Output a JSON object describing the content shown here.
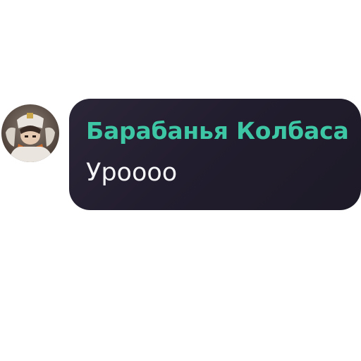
{
  "message": {
    "sender_name": "Барабанья Колбаса",
    "text": "Уроооо",
    "avatar_icon": "user-avatar-icon"
  },
  "colors": {
    "sender_name": "#3ec7a4",
    "bubble_background": "#221d2e",
    "message_text": "#f5f5f7",
    "page_background": "#ffffff"
  }
}
